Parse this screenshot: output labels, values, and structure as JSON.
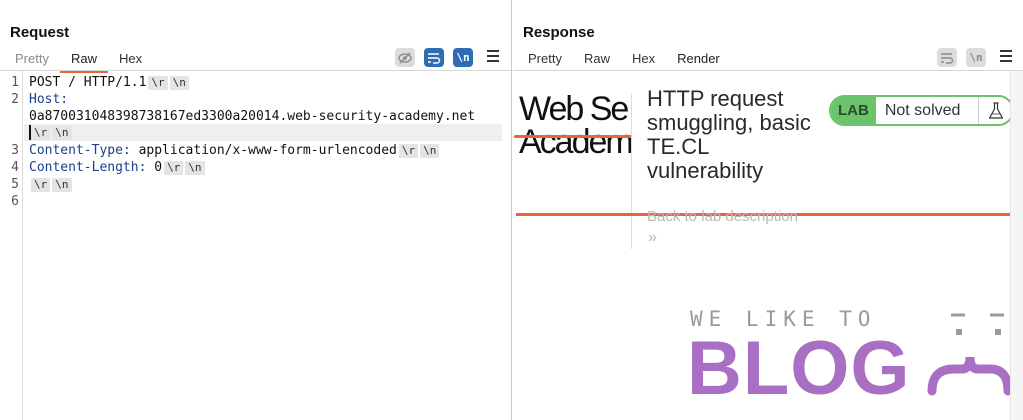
{
  "request": {
    "title": "Request",
    "tabs": [
      {
        "label": "Pretty",
        "state": "dim"
      },
      {
        "label": "Raw",
        "state": "active"
      },
      {
        "label": "Hex",
        "state": "normal"
      }
    ],
    "toolbar": {
      "hide_icon": "eye-slash-icon",
      "wrap_icon": "wrap-lines-icon",
      "newline_label": "\\n",
      "menu_icon": "hamburger-menu-icon"
    },
    "line_numbers": [
      "1",
      "2",
      "3",
      "4",
      "5",
      "6"
    ],
    "lines": {
      "l1_text": "POST / HTTP/1.1",
      "l2_name": "Host:",
      "l2_value": "0a870031048398738167ed3300a20014.web-security-academy.net",
      "l3_name": "Content-Type:",
      "l3_value": " application/x-www-form-urlencoded",
      "l4_name": "Content-Length:",
      "l4_value": " 0"
    },
    "crlf_tokens": [
      "\\r",
      "\\n"
    ]
  },
  "response": {
    "title": "Response",
    "tabs": [
      {
        "label": "Pretty",
        "state": "normal"
      },
      {
        "label": "Raw",
        "state": "normal"
      },
      {
        "label": "Hex",
        "state": "normal"
      },
      {
        "label": "Render",
        "state": "active"
      }
    ],
    "toolbar": {
      "wrap_icon": "wrap-lines-icon",
      "newline_label": "\\n",
      "menu_icon": "hamburger-menu-icon"
    },
    "render": {
      "logo_line1": "Web Se",
      "logo_line2": "Academ",
      "lab_title": "HTTP request smuggling, basic TE.CL vulnerability",
      "lab_badge": "LAB",
      "lab_status": "Not solved",
      "back_link": "Back to lab description",
      "chevrons": "»",
      "banner_top": "WE LIKE TO",
      "banner_main": "BLOG"
    }
  },
  "view_toggles": [
    {
      "icon": "split-vertical-icon",
      "active": true
    },
    {
      "icon": "split-horizontal-icon",
      "active": false
    },
    {
      "icon": "single-pane-icon",
      "active": false
    }
  ],
  "colors": {
    "accent_orange": "#e8643c",
    "burp_blue": "#2e6db4",
    "lab_green": "#6bc46c",
    "blog_purple": "#a86fc4",
    "header_name_blue": "#1e3e8f"
  }
}
